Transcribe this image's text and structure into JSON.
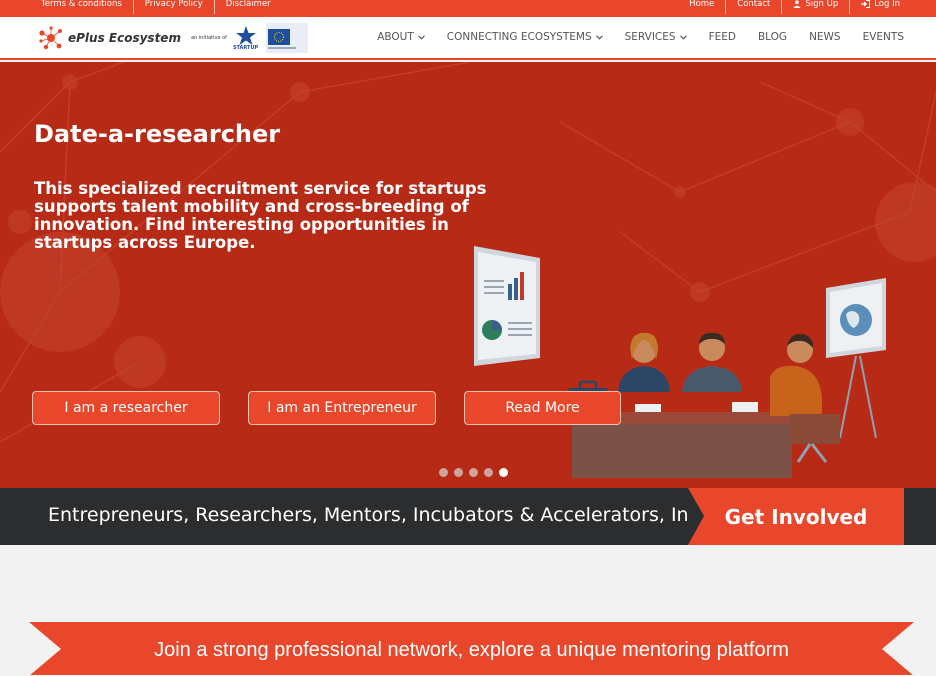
{
  "topbar": {
    "left_links": [
      "Terms & conditions",
      "Privacy Policy",
      "Disclaimer"
    ],
    "right_links": [
      "Home",
      "Contact",
      "Sign Up",
      "Log In"
    ]
  },
  "header": {
    "logo_text": "ePlus Ecosystem",
    "initiative_text": "an initiative of",
    "startup_label": "STARTUP",
    "nav": [
      "ABOUT",
      "CONNECTING ECOSYSTEMS",
      "SERVICES",
      "FEED",
      "BLOG",
      "NEWS",
      "EVENTS"
    ]
  },
  "hero": {
    "title": "Date-a-researcher",
    "description": "This specialized recruitment service for startups supports talent mobility and cross-breeding of innovation. Find interesting opportunities in startups across Europe.",
    "buttons": [
      "I am a researcher",
      "I am an Entrepreneur",
      "Read More"
    ],
    "slide_count": 5,
    "active_slide": 5
  },
  "band": {
    "text": "Entrepreneurs, Researchers, Mentors, Incubators & Accelerators, Investors",
    "cta": "Get Involved"
  },
  "ribbon": {
    "text": "Join a strong professional network, explore a unique mentoring platform"
  },
  "colors": {
    "accent": "#e8472b",
    "hero_bg": "#b72a16",
    "band_bg": "#2c2d2f"
  }
}
